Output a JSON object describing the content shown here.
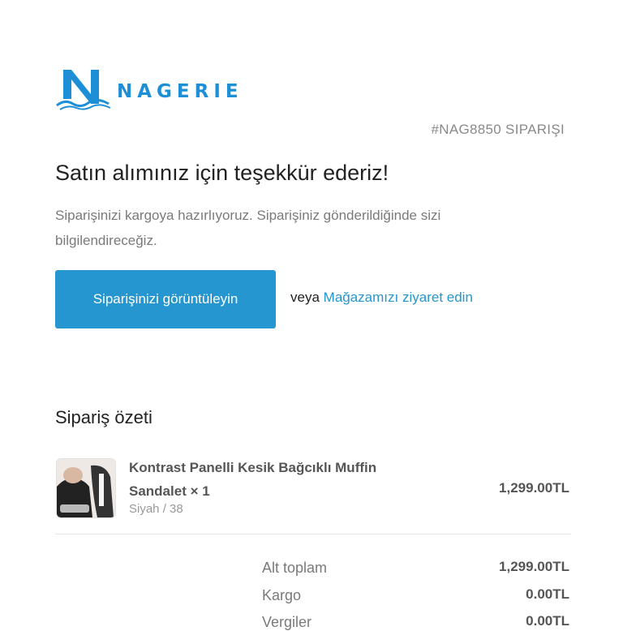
{
  "brand": {
    "name": "NAGERIE",
    "accent_color": "#1d8fd6",
    "logo_icon": "wave-n-logo-icon"
  },
  "order": {
    "number_label": "#NAG8850 SIPARIŞI"
  },
  "header": {
    "title": "Satın alımınız için teşekkür ederiz!",
    "subtitle": "Siparişinizi kargoya hazırlıyoruz. Siparişiniz gönderildiğinde sizi bilgilendireceğiz."
  },
  "actions": {
    "view_order_label": "Siparişinizi görüntüleyin",
    "button_color": "#2596cf",
    "or_text": "veya",
    "store_link_label": "Mağazamızı ziyaret edin"
  },
  "summary": {
    "title": "Sipariş özeti",
    "items": [
      {
        "name": "Kontrast Panelli Kesik Bağcıklı Muffin Sandalet × 1",
        "variant": "Siyah / 38",
        "price": "1,299.00TL"
      }
    ],
    "totals": [
      {
        "label": "Alt toplam",
        "value": "1,299.00TL"
      },
      {
        "label": "Kargo",
        "value": "0.00TL"
      },
      {
        "label": "Vergiler",
        "value": "0.00TL"
      }
    ]
  }
}
